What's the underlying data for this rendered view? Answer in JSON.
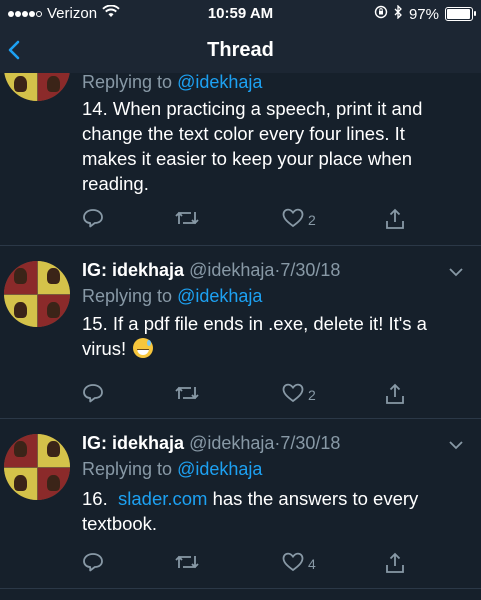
{
  "status_bar": {
    "carrier": "Verizon",
    "time": "10:59 AM",
    "battery": "97%",
    "battery_level": 0.97
  },
  "nav": {
    "title": "Thread"
  },
  "tweets": [
    {
      "replying_prefix": "Replying to",
      "replying_to": "@idekhaja",
      "text": "14. When practicing a speech, print it and change the text color every four lines. It makes it easier to keep your place when reading.",
      "likes": "2"
    },
    {
      "display_name": "IG: idekhaja",
      "handle": "@idekhaja",
      "dot": "·",
      "date": "7/30/18",
      "replying_prefix": "Replying to",
      "replying_to": "@idekhaja",
      "text": "15. If a pdf file ends in .exe, delete it! It's a virus!",
      "emoji": "grinning-sweat-emoji",
      "likes": "2"
    },
    {
      "display_name": "IG: idekhaja",
      "handle": "@idekhaja",
      "dot": "·",
      "date": "7/30/18",
      "replying_prefix": "Replying to",
      "replying_to": "@idekhaja",
      "text_prefix": "16.",
      "link": "slader.com",
      "text_suffix": "has the answers to every textbook.",
      "likes": "4"
    }
  ],
  "colors": {
    "background": "#16202b",
    "link": "#1da1f2",
    "muted": "#8899a6"
  }
}
